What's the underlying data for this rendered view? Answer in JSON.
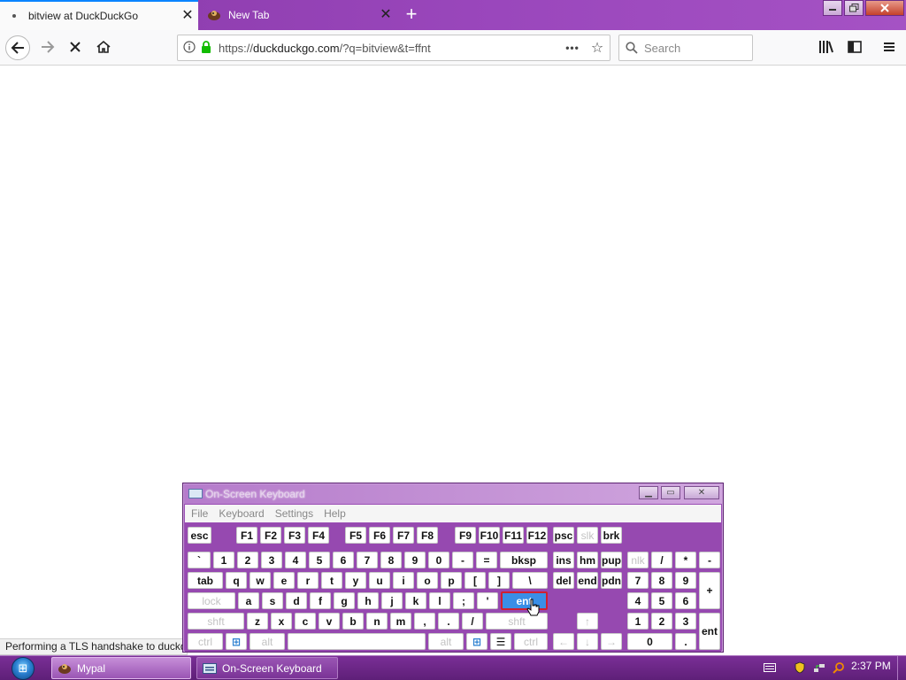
{
  "browser": {
    "tabs": [
      {
        "label": "bitview at DuckDuckGo",
        "active": true
      },
      {
        "label": "New Tab",
        "active": false
      }
    ],
    "new_tab_label": "+",
    "url": {
      "scheme": "https://",
      "host": "duckduckgo.com",
      "path": "/?q=bitview&t=ffnt"
    },
    "page_actions": "•••",
    "search_placeholder": "Search",
    "status_text": "Performing a TLS handshake to duckduckgo.com...",
    "accent_color": "#0a84ff"
  },
  "osk": {
    "title": "On-Screen Keyboard",
    "menu": [
      "File",
      "Keyboard",
      "Settings",
      "Help"
    ],
    "rows": {
      "fn": [
        "esc",
        "F1",
        "F2",
        "F3",
        "F4",
        "F5",
        "F6",
        "F7",
        "F8",
        "F9",
        "F10",
        "F11",
        "F12",
        "psc",
        "slk",
        "brk"
      ],
      "num": [
        "`",
        "1",
        "2",
        "3",
        "4",
        "5",
        "6",
        "7",
        "8",
        "9",
        "0",
        "-",
        "=",
        "bksp",
        "ins",
        "hm",
        "pup",
        "nlk",
        "/",
        "*",
        "-"
      ],
      "tab": [
        "tab",
        "q",
        "w",
        "e",
        "r",
        "t",
        "y",
        "u",
        "i",
        "o",
        "p",
        "[",
        "]",
        "\\",
        "del",
        "end",
        "pdn",
        "7",
        "8",
        "9",
        "+"
      ],
      "caps": [
        "lock",
        "a",
        "s",
        "d",
        "f",
        "g",
        "h",
        "j",
        "k",
        "l",
        ";",
        "'",
        "ent",
        "4",
        "5",
        "6"
      ],
      "shift": [
        "shft",
        "z",
        "x",
        "c",
        "v",
        "b",
        "n",
        "m",
        ",",
        ".",
        "/",
        "shft",
        "↑",
        "1",
        "2",
        "3",
        "ent"
      ],
      "ctrl": [
        "ctrl",
        "⊞",
        "alt",
        "",
        "alt",
        "⊞",
        "☰",
        "ctrl",
        "←",
        "↓",
        "→",
        "0",
        "."
      ]
    },
    "highlight_color": "#3a8ee6"
  },
  "taskbar": {
    "items": [
      {
        "label": "Mypal",
        "active": true
      },
      {
        "label": "On-Screen Keyboard",
        "active": false
      }
    ],
    "clock": "2:37 PM"
  }
}
